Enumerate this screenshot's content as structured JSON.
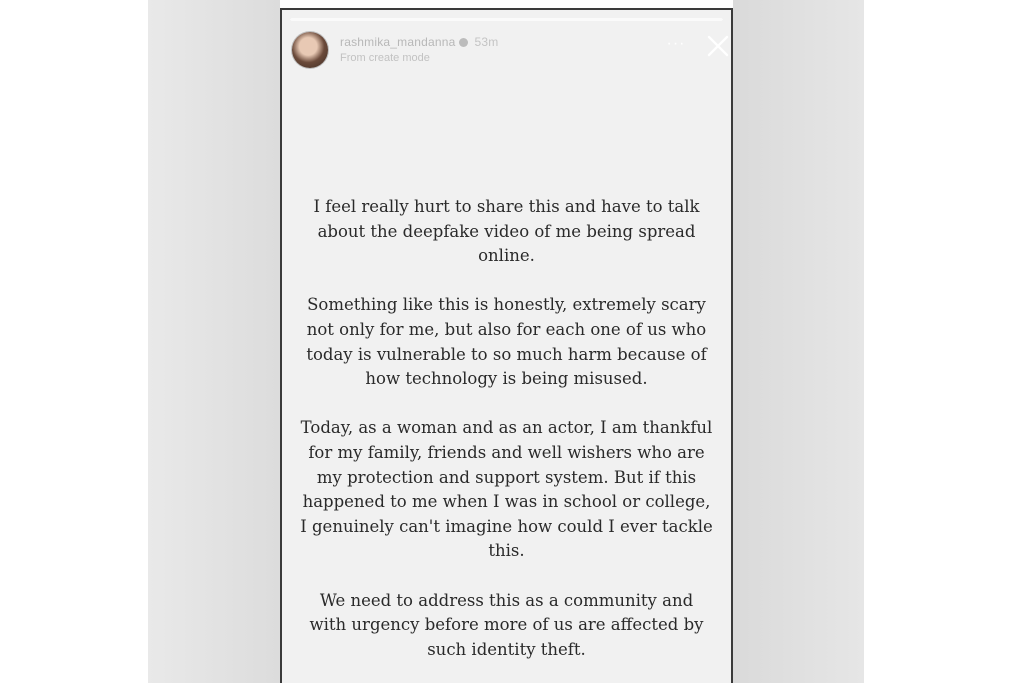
{
  "story": {
    "username": "rashmika_mandanna",
    "time": "53m",
    "subtitle": "From create mode",
    "more_label": "···",
    "progress": 1.0,
    "paragraphs": [
      [
        "I feel really hurt to share this and have to talk",
        "about the deepfake video of me being spread",
        "online."
      ],
      [
        "Something like this is honestly, extremely scary",
        "not only for me, but also for each one of us who",
        "today is vulnerable to so much harm because of",
        "how technology is being misused."
      ],
      [
        "Today, as a woman and as an actor, I am thankful",
        "for my family, friends and well wishers who are",
        "my protection and support system. But if this",
        "happened to me when I was in school or college,",
        "I genuinely can't imagine how could I ever tackle",
        "this."
      ],
      [
        "We need to address this as a community and",
        "with urgency before more of us are affected by",
        "such identity theft."
      ]
    ]
  }
}
